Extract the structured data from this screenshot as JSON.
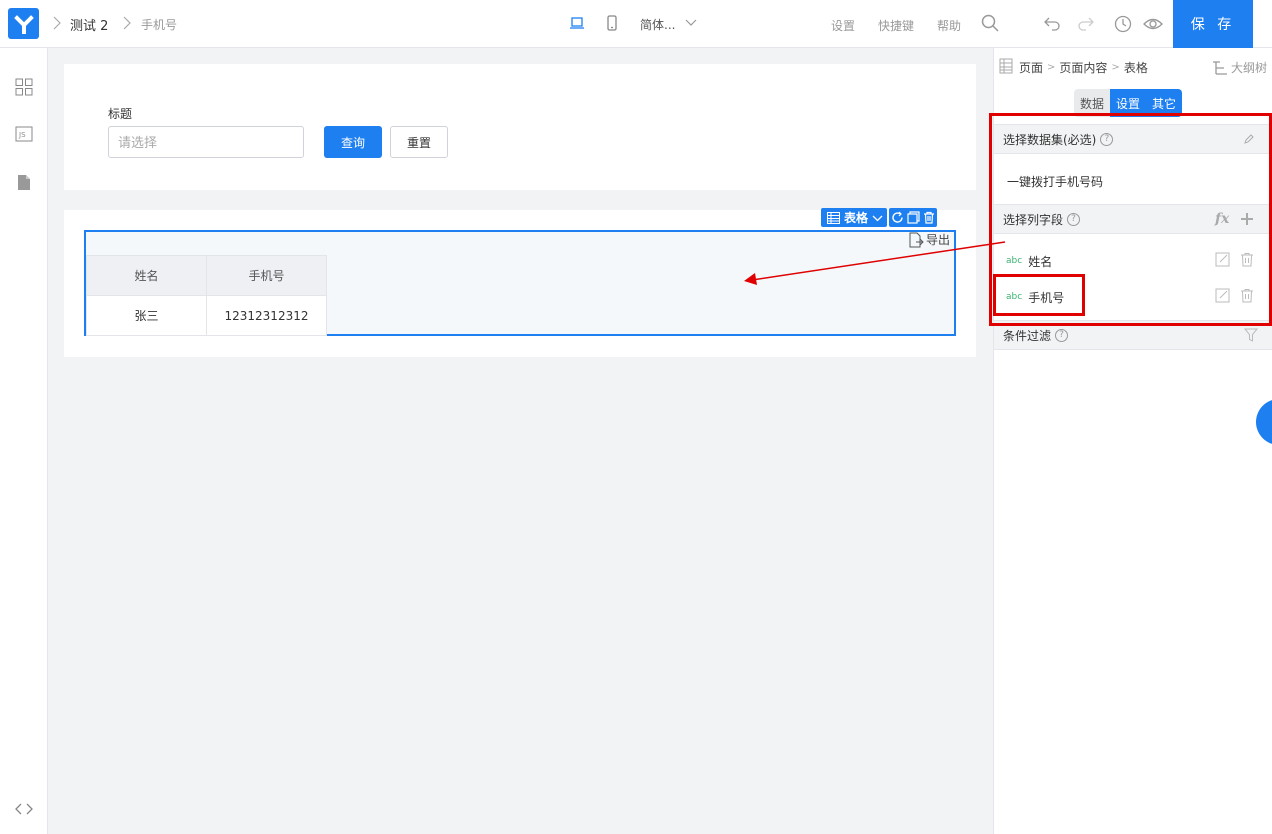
{
  "header": {
    "breadcrumb": [
      "测试 2",
      "手机号"
    ],
    "language": "简体...",
    "links": [
      "设置",
      "快捷键",
      "帮助"
    ],
    "save_label": "保 存"
  },
  "form": {
    "field_label": "标题",
    "field_placeholder": "请选择",
    "query_label": "查询",
    "reset_label": "重置"
  },
  "table_component": {
    "toolbar_label": "表格",
    "export_label": "导出",
    "columns": [
      "姓名",
      "手机号"
    ],
    "rows": [
      [
        "张三",
        "12312312312"
      ]
    ]
  },
  "right_panel": {
    "breadcrumb": [
      "页面",
      "页面内容",
      "表格"
    ],
    "outline_label": "大纲树",
    "tabs": [
      "数据",
      "设置",
      "其它"
    ],
    "active_tab": "设置",
    "dataset_section_label": "选择数据集(必选)",
    "dataset_value": "一键拨打手机号码",
    "columns_section_label": "选择列字段",
    "fields": [
      {
        "type": "abc",
        "name": "姓名"
      },
      {
        "type": "abc",
        "name": "手机号"
      }
    ],
    "filter_section_label": "条件过滤"
  },
  "colors": {
    "accent": "#1e7ff0",
    "highlight": "#e00000"
  }
}
